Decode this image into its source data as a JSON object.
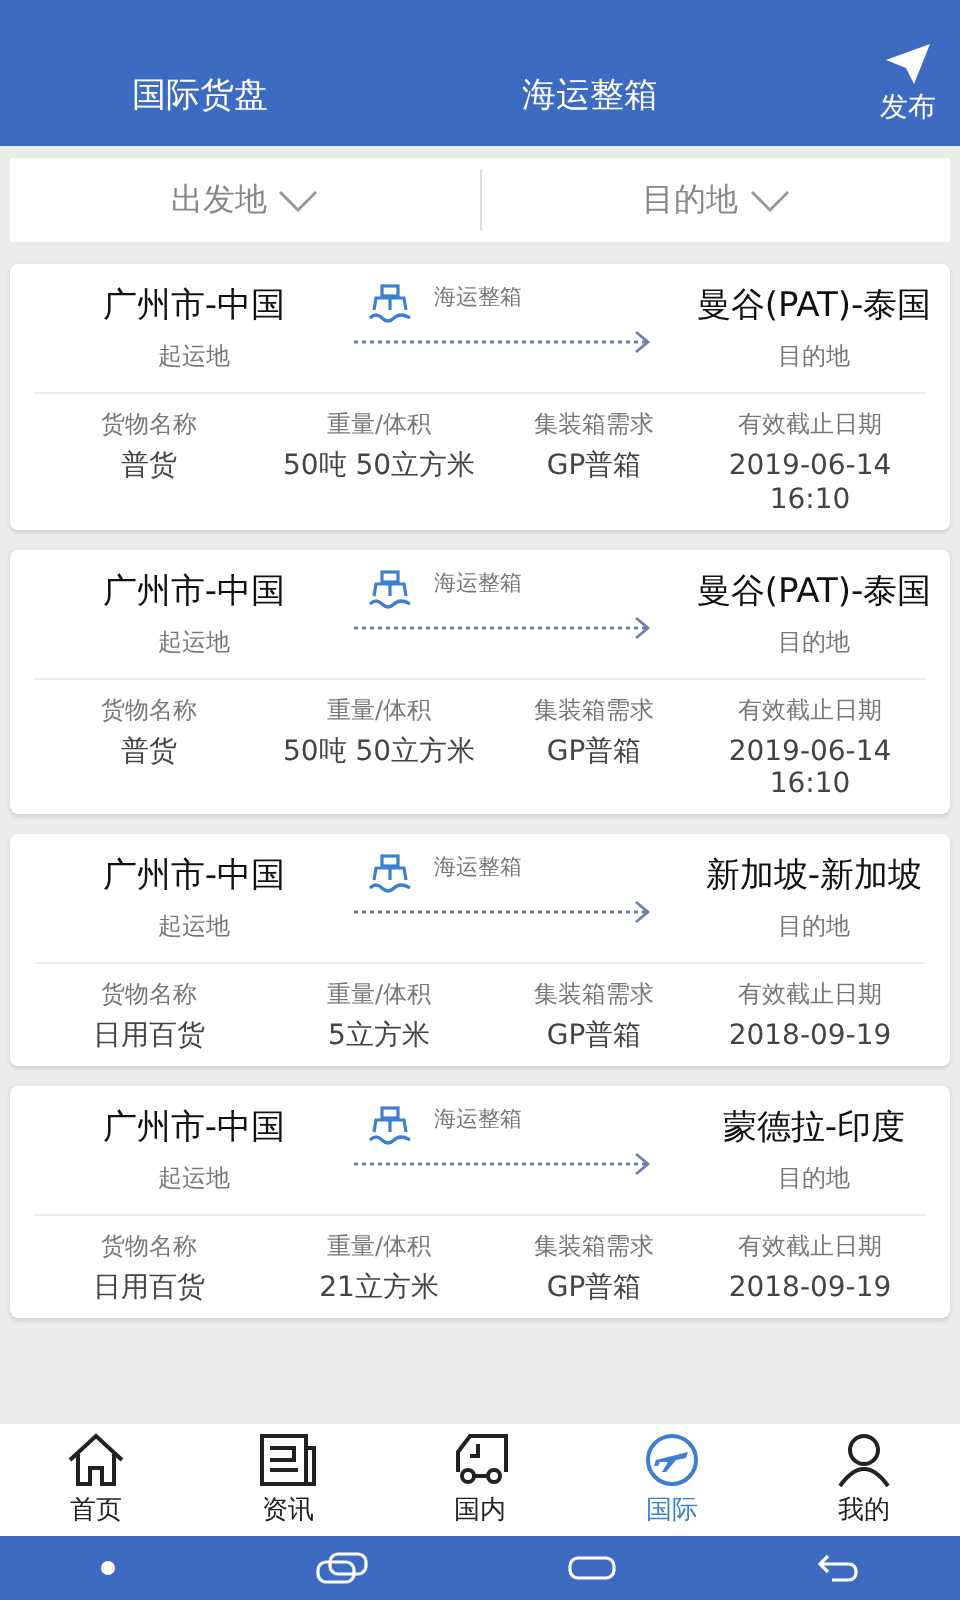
{
  "header": {
    "titles": [
      "国际货盘",
      "海运整箱"
    ],
    "publish": "发布"
  },
  "filters": [
    {
      "label": "出发地"
    },
    {
      "label": "目的地"
    }
  ],
  "cards": [
    {
      "origin": "广州市-中国",
      "origin_label": "起运地",
      "mode": "海运整箱",
      "destination": "曼谷(PAT)-泰国",
      "destination_label": "目的地",
      "fields": [
        {
          "label": "货物名称",
          "value": "普货"
        },
        {
          "label": "重量/体积",
          "value": "50吨 50立方米"
        },
        {
          "label": "集装箱需求",
          "value": "GP普箱"
        },
        {
          "label": "有效截止日期",
          "value": "2019-06-14\n16:10"
        }
      ]
    },
    {
      "origin": "广州市-中国",
      "origin_label": "起运地",
      "mode": "海运整箱",
      "destination": "曼谷(PAT)-泰国",
      "destination_label": "目的地",
      "fields": [
        {
          "label": "货物名称",
          "value": "普货"
        },
        {
          "label": "重量/体积",
          "value": "50吨 50立方米"
        },
        {
          "label": "集装箱需求",
          "value": "GP普箱"
        },
        {
          "label": "有效截止日期",
          "value": "2019-06-14\n16:10"
        }
      ]
    },
    {
      "origin": "广州市-中国",
      "origin_label": "起运地",
      "mode": "海运整箱",
      "destination": "新加坡-新加坡",
      "destination_label": "目的地",
      "fields": [
        {
          "label": "货物名称",
          "value": "日用百货"
        },
        {
          "label": "重量/体积",
          "value": "5立方米"
        },
        {
          "label": "集装箱需求",
          "value": "GP普箱"
        },
        {
          "label": "有效截止日期",
          "value": "2018-09-19"
        }
      ]
    },
    {
      "origin": "广州市-中国",
      "origin_label": "起运地",
      "mode": "海运整箱",
      "destination": "蒙德拉-印度",
      "destination_label": "目的地",
      "fields": [
        {
          "label": "货物名称",
          "value": "日用百货"
        },
        {
          "label": "重量/体积",
          "value": "21立方米"
        },
        {
          "label": "集装箱需求",
          "value": "GP普箱"
        },
        {
          "label": "有效截止日期",
          "value": "2018-09-19"
        }
      ]
    }
  ],
  "bottom_nav": [
    {
      "label": "首页",
      "selected": false
    },
    {
      "label": "资讯",
      "selected": false
    },
    {
      "label": "国内",
      "selected": false
    },
    {
      "label": "国际",
      "selected": true
    },
    {
      "label": "我的",
      "selected": false
    }
  ]
}
